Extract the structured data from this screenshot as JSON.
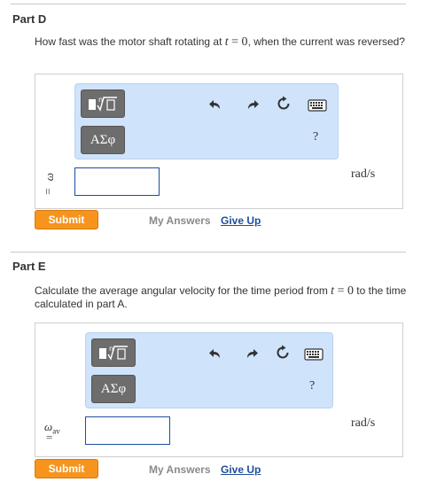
{
  "partD": {
    "title": "Part D",
    "question_pre": "How fast was the motor shaft rotating at ",
    "question_var": "t",
    "question_eq": " = 0",
    "question_post": ", when the current was reversed?",
    "variable": "ω",
    "equals": "=",
    "input_value": "",
    "units": "rad/s",
    "submit_label": "Submit",
    "my_answers_label": "My Answers",
    "give_up_label": "Give Up"
  },
  "partE": {
    "title": "Part E",
    "question_pre": "Calculate the average angular velocity for the time period from ",
    "question_var": "t",
    "question_eq": " = 0",
    "question_post": " to the time calculated in part A.",
    "variable": "ω",
    "variable_sub": "av",
    "equals": "=",
    "input_value": "",
    "units": "rad/s",
    "submit_label": "Submit",
    "my_answers_label": "My Answers",
    "give_up_label": "Give Up"
  },
  "toolbar": {
    "symbols_label": "ΑΣφ",
    "help_label": "?"
  },
  "colors": {
    "submit": "#f7941d",
    "toolbar_bg": "#cfe3fb",
    "link": "#1f4e9a",
    "input_border": "#1a4fa0"
  }
}
